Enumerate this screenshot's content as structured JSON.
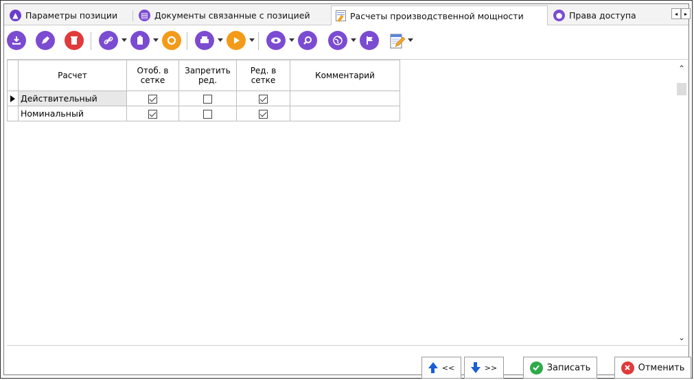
{
  "tabs": [
    {
      "label": "Параметры позиции",
      "icon": "caret-up-circle-icon",
      "color": "#6a3fc9"
    },
    {
      "label": "Документы связанные с позицией",
      "icon": "document-circle-icon",
      "color": "#7b4bd1"
    },
    {
      "label": "Расчеты производственной мощности",
      "icon": "pencil-note-icon",
      "color": "#e5a12b",
      "active": true
    },
    {
      "label": "Права доступа",
      "icon": "user-circle-icon",
      "color": "#7b4bd1"
    }
  ],
  "tab_scroll": {
    "left": "◂",
    "right": "▸"
  },
  "toolbar": {
    "colors": {
      "download": "#7b4bd1",
      "edit": "#7b4bd1",
      "delete": "#e03a3a",
      "link": "#7b4bd1",
      "copy": "#7b4bd1",
      "refresh": "#f39b19",
      "print": "#7b4bd1",
      "run": "#f39b19",
      "view": "#7b4bd1",
      "search": "#7b4bd1",
      "globe": "#7b4bd1",
      "flag": "#7b4bd1"
    }
  },
  "grid": {
    "headers": [
      "Расчет",
      "Отоб. в\nсетке",
      "Запретить\nред.",
      "Ред. в\nсетке",
      "Комментарий"
    ],
    "rows": [
      {
        "name": "Действительный",
        "show": true,
        "forbid": false,
        "edit": true,
        "comment": ""
      },
      {
        "name": "Номинальный",
        "show": true,
        "forbid": false,
        "edit": true,
        "comment": ""
      }
    ]
  },
  "buttons": {
    "prev": "<<",
    "next": ">>",
    "save": "Записать",
    "cancel": "Отменить"
  }
}
